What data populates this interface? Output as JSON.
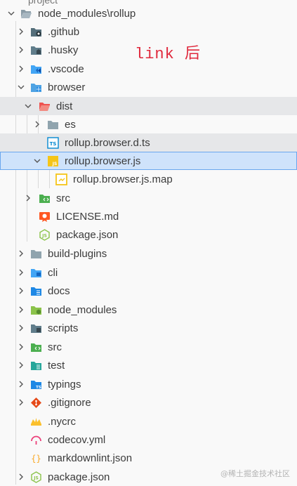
{
  "root": {
    "label": "node_modules\\rollup"
  },
  "top_partial": "project",
  "annotation": "link 后",
  "watermark": "@稀土掘金技术社区",
  "nodes": [
    {
      "label": ".github",
      "icon": "github-folder-icon"
    },
    {
      "label": ".husky",
      "icon": "husky-folder-icon"
    },
    {
      "label": ".vscode",
      "icon": "vscode-folder-icon"
    },
    {
      "label": "browser",
      "icon": "browser-folder-icon"
    },
    {
      "label": "dist",
      "icon": "dist-folder-icon"
    },
    {
      "label": "es",
      "icon": "folder-icon"
    },
    {
      "label": "rollup.browser.d.ts",
      "icon": "typescript-def-icon"
    },
    {
      "label": "rollup.browser.js",
      "icon": "javascript-file-icon"
    },
    {
      "label": "rollup.browser.js.map",
      "icon": "js-map-file-icon"
    },
    {
      "label": "src",
      "icon": "src-folder-icon"
    },
    {
      "label": "LICENSE.md",
      "icon": "license-icon"
    },
    {
      "label": "package.json",
      "icon": "nodejs-icon"
    },
    {
      "label": "build-plugins",
      "icon": "folder-icon"
    },
    {
      "label": "cli",
      "icon": "cli-folder-icon"
    },
    {
      "label": "docs",
      "icon": "docs-folder-icon"
    },
    {
      "label": "node_modules",
      "icon": "node-modules-folder-icon"
    },
    {
      "label": "scripts",
      "icon": "scripts-folder-icon"
    },
    {
      "label": "src",
      "icon": "src-folder-icon"
    },
    {
      "label": "test",
      "icon": "test-folder-icon"
    },
    {
      "label": "typings",
      "icon": "typings-folder-icon"
    },
    {
      "label": ".gitignore",
      "icon": "git-icon"
    },
    {
      "label": ".nycrc",
      "icon": "nyc-icon"
    },
    {
      "label": "codecov.yml",
      "icon": "codecov-icon"
    },
    {
      "label": "markdownlint.json",
      "icon": "json-icon"
    },
    {
      "label": "package.json",
      "icon": "nodejs-icon"
    }
  ],
  "colors": {
    "selected_bg": "#cfe3fb",
    "selected_border": "#6aa7ee",
    "hover_bg": "#e6e7e9",
    "annotation": "#e0283c"
  }
}
